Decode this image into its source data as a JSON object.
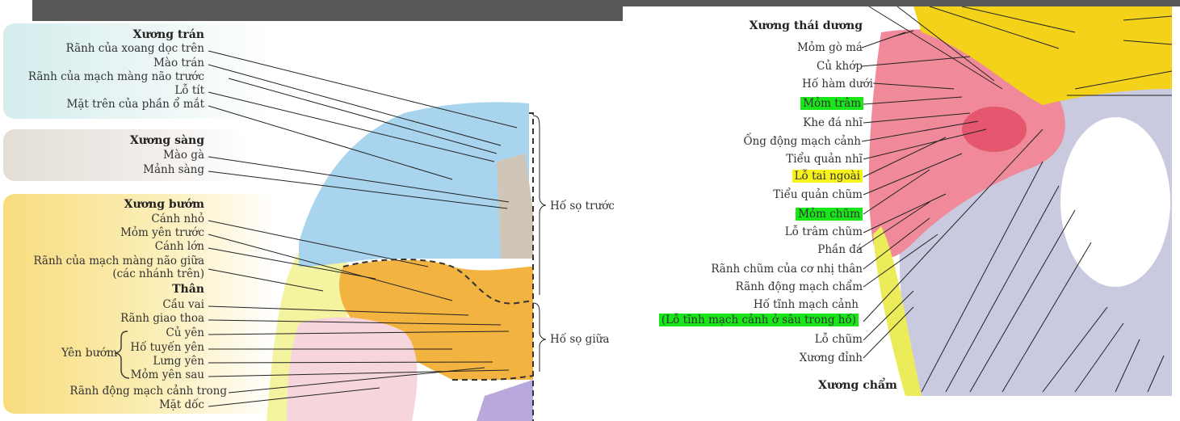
{
  "left": {
    "groups": {
      "frontal": {
        "title": "Xương trán",
        "items": [
          "Rãnh của xoang dọc trên",
          "Mào trán",
          "Rãnh của mạch màng não trước",
          "Lỗ tít",
          "Mặt trên của phần ổ mắt"
        ]
      },
      "ethmoid": {
        "title": "Xương sàng",
        "items": [
          "Mào gà",
          "Mảnh sàng"
        ]
      },
      "sphenoid": {
        "title": "Xương bướm",
        "items": [
          "Cánh nhỏ",
          "Mỏm yên trước",
          "Cánh lớn",
          "Rãnh của mạch màng não giữa",
          "(các nhánh trên)"
        ],
        "body_title": "Thân",
        "body_items": [
          "Cầu vai",
          "Rãnh giao thoa"
        ],
        "sella_label": "Yên bướm",
        "sella_items": [
          "Củ yên",
          "Hố tuyến yên",
          "Lưng yên",
          "Mỏm yên sau"
        ],
        "tail_items": [
          "Rãnh động mạch cảnh trong",
          "Mặt dốc"
        ]
      }
    },
    "fossae": {
      "anterior": "Hố sọ trước",
      "middle": "Hố sọ giữa"
    },
    "colors": {
      "frontal": "#a9d4ee",
      "ethmoid": "#d8d0c4",
      "sphenoid": "#f2b340",
      "temporal": "#f4dede",
      "parietal": "#e8e870"
    }
  },
  "right": {
    "labels": [
      {
        "text": "Xương thái dương",
        "style": "plain"
      },
      {
        "text": "Mỏm gò má",
        "style": "plain"
      },
      {
        "text": "Củ khớp",
        "style": "plain"
      },
      {
        "text": "Hố hàm dưới",
        "style": "plain"
      },
      {
        "text": "Mỏm trâm",
        "style": "green"
      },
      {
        "text": "Khe đá nhĩ",
        "style": "plain"
      },
      {
        "text": "Ống động mạch cảnh",
        "style": "plain"
      },
      {
        "text": "Tiểu quản nhĩ",
        "style": "plain"
      },
      {
        "text": "Lỗ tai ngoài",
        "style": "yellow"
      },
      {
        "text": "Tiểu quản chũm",
        "style": "plain"
      },
      {
        "text": "Mỏm chũm",
        "style": "green"
      },
      {
        "text": "Lỗ trâm chũm",
        "style": "plain"
      },
      {
        "text": "Phần đá",
        "style": "plain"
      },
      {
        "text": "Rãnh chũm của cơ nhị thân",
        "style": "plain"
      },
      {
        "text": "Rãnh động mạch chẩm",
        "style": "plain"
      },
      {
        "text": "Hố tĩnh mạch cảnh",
        "style": "plain"
      },
      {
        "text": "(Lỗ tĩnh mạch cảnh ở sâu trong hố)",
        "style": "green"
      },
      {
        "text": "Lỗ chũm",
        "style": "plain"
      },
      {
        "text": "Xương đỉnh",
        "style": "plain"
      }
    ],
    "bottom_title": "Xương chẩm",
    "colors": {
      "occipital": "#c9c9e0",
      "temporal": "#f08a9a",
      "sphenoid": "#f5d21a",
      "parietal": "#ecec5a",
      "highlight_green": "#19e619",
      "highlight_yellow": "#f7f21a"
    }
  }
}
